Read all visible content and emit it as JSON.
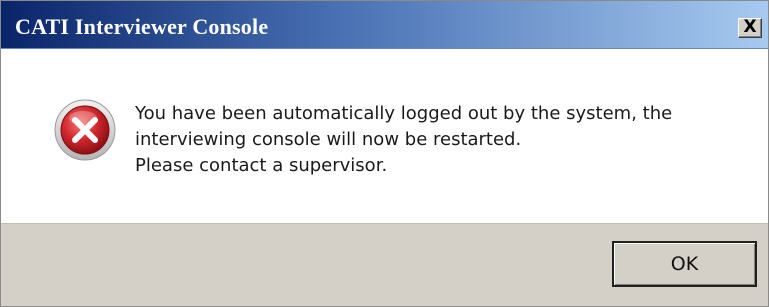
{
  "window": {
    "title": "CATI Interviewer Console",
    "close_label": "X"
  },
  "dialog": {
    "icon": "error-icon",
    "message_lines": [
      "You have been automatically logged out by the system, the",
      "interviewing console will now be restarted.",
      "Please contact a supervisor."
    ],
    "ok_label": "OK"
  },
  "colors": {
    "titlebar_start": "#0a246a",
    "titlebar_end": "#a6caf0",
    "error_red": "#d0272c",
    "button_face": "#d4d0c8"
  }
}
